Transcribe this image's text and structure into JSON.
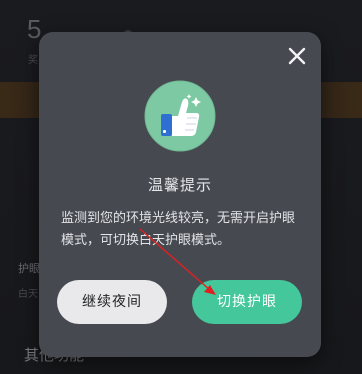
{
  "background": {
    "big_number": "5",
    "small_label": "奖",
    "row_label": "护眼",
    "row_sub": "白天",
    "section_title": "其他功能"
  },
  "dialog": {
    "close_icon": "close-icon",
    "illustration_icon": "thumbs-up-icon",
    "title": "温馨提示",
    "message": "监测到您的环境光线较亮，无需开启护眼模式，可切换白天护眼模式。",
    "continue_button": "继续夜间",
    "switch_button": "切换护眼"
  },
  "colors": {
    "dialog_bg": "#474951",
    "switch_button": "#43c79b",
    "continue_button": "#e9e9ec",
    "icon_circle": "#7cc9a3",
    "thumb": "#2f6fd1",
    "annotation_arrow": "#e02020"
  }
}
